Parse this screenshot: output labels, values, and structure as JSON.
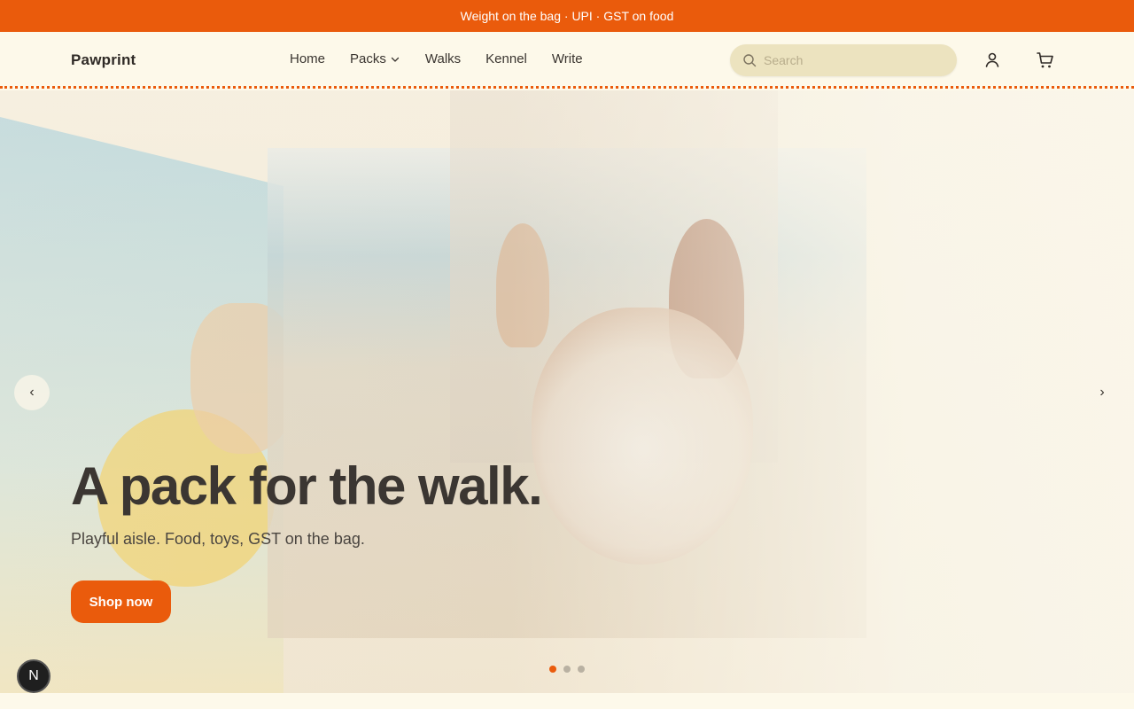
{
  "announcement": {
    "text": "Weight on the bag · UPI · GST on food"
  },
  "header": {
    "logo": "Pawprint",
    "nav": [
      {
        "label": "Home"
      },
      {
        "label": "Packs",
        "has_dropdown": true
      },
      {
        "label": "Walks"
      },
      {
        "label": "Kennel"
      },
      {
        "label": "Write"
      }
    ],
    "search": {
      "placeholder": "Search",
      "value": ""
    },
    "icons": [
      "search-icon",
      "user-icon",
      "cart-icon"
    ]
  },
  "hero": {
    "title": "A pack for the walk.",
    "subtitle": "Playful aisle. Food, toys, GST on the bag.",
    "cta": "Shop now",
    "prev": "‹",
    "next": "›",
    "slides_count": 3,
    "active_slide": 1
  },
  "badge": {
    "label": "N"
  },
  "colors": {
    "accent": "#ea5b0c",
    "background": "#fdf9ea",
    "search_bg": "#ece3bf",
    "text": "#3b3632"
  }
}
